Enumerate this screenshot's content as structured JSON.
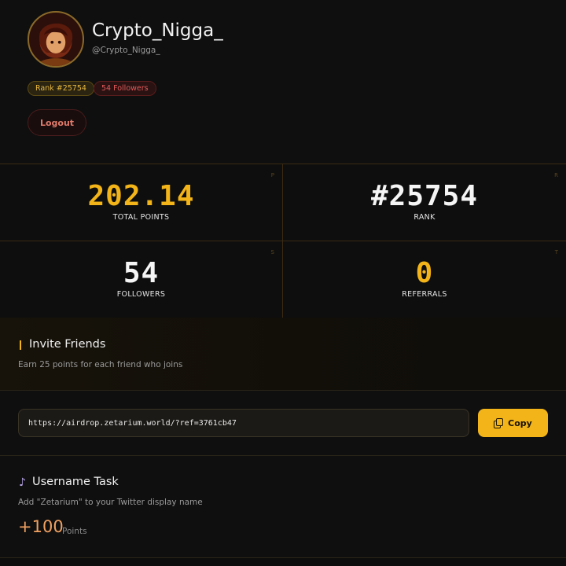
{
  "profile": {
    "display_name": "Crypto_Nigga_",
    "handle": "@Crypto_Nigga_",
    "rank_badge": "Rank #25754",
    "followers_badge": "54 Followers",
    "logout_label": "Logout",
    "avatar_icon": "user-avatar"
  },
  "stats": [
    {
      "value": "202.14",
      "label": "TOTAL POINTS",
      "corner": "P",
      "color": "#f2b418"
    },
    {
      "value": "#25754",
      "label": "RANK",
      "corner": "R",
      "color": "#f5f5f5"
    },
    {
      "value": "54",
      "label": "FOLLOWERS",
      "corner": "S",
      "color": "#f5f5f5"
    },
    {
      "value": "0",
      "label": "REFERRALS",
      "corner": "T",
      "color": "#f2b418"
    }
  ],
  "invite": {
    "title": "Invite Friends",
    "description": "Earn 25 points for each friend who joins",
    "link": "https://airdrop.zetarium.world/?ref=3761cb47",
    "copy_label": "Copy",
    "copy_icon": "copy-icon"
  },
  "username_task": {
    "icon": "♪",
    "title": "Username Task",
    "description": "Add \"Zetarium\" to your Twitter display name",
    "points": "+100",
    "points_unit": "Points"
  },
  "colors": {
    "accent": "#f2b418",
    "background": "#0d0d0d",
    "danger": "#e05a5a"
  }
}
